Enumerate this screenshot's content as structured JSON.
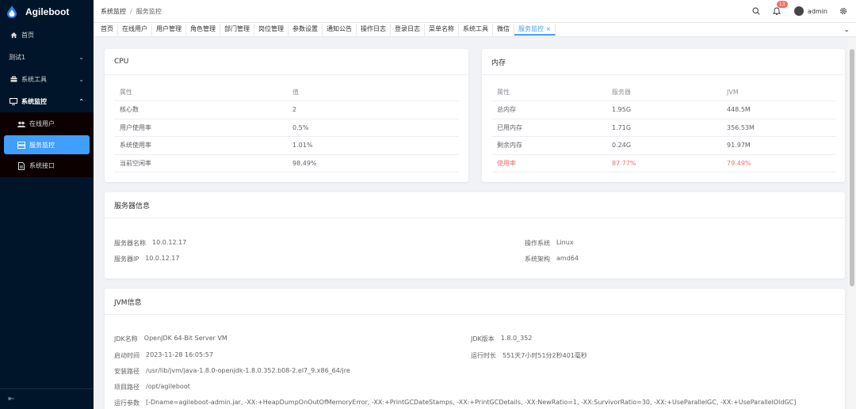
{
  "app": {
    "name": "Agileboot"
  },
  "sidebar": {
    "items": [
      {
        "label": "首页",
        "icon": "home-icon"
      },
      {
        "label": "测试1",
        "icon": ""
      },
      {
        "label": "系统工具",
        "icon": "toolbox-icon"
      },
      {
        "label": "系统监控",
        "icon": "monitor-icon"
      }
    ],
    "sub_items": [
      {
        "label": "在线用户",
        "icon": "users-icon"
      },
      {
        "label": "服务监控",
        "icon": "server-icon"
      },
      {
        "label": "系统接口",
        "icon": "document-icon"
      }
    ],
    "collapse_icon": "collapse-icon"
  },
  "header": {
    "breadcrumb": [
      "系统监控",
      "服务监控"
    ],
    "notice_count": "13",
    "username": "admin"
  },
  "tags": [
    "首页",
    "在线用户",
    "用户管理",
    "角色管理",
    "部门管理",
    "岗位管理",
    "参数设置",
    "通知公告",
    "操作日志",
    "登录日志",
    "菜单名称",
    "系统工具",
    "微信",
    "服务监控 ×"
  ],
  "cpu": {
    "title": "CPU",
    "headers": [
      "属性",
      "值"
    ],
    "rows": [
      [
        "核心数",
        "2"
      ],
      [
        "用户使用率",
        "0.5%"
      ],
      [
        "系统使用率",
        "1.01%"
      ],
      [
        "当前空闲率",
        "98.49%"
      ]
    ]
  },
  "memory": {
    "title": "内存",
    "headers": [
      "属性",
      "服务器",
      "JVM"
    ],
    "rows": [
      [
        "总内存",
        "1.95G",
        "448.5M"
      ],
      [
        "已用内存",
        "1.71G",
        "356.53M"
      ],
      [
        "剩余内存",
        "0.24G",
        "91.97M"
      ],
      [
        "使用率",
        "87.77%",
        "79.49%"
      ]
    ],
    "warn_color": "#f56c6c"
  },
  "server": {
    "title": "服务器信息",
    "name_label": "服务器名称",
    "name_value": "10.0.12.17",
    "ip_label": "服务器IP",
    "ip_value": "10.0.12.17",
    "os_label": "操作系统",
    "os_value": "Linux",
    "arch_label": "系统架构",
    "arch_value": "amd64"
  },
  "jvm": {
    "title": "JVM信息",
    "name_label": "JDK名称",
    "name_value": "OpenJDK 64-Bit Server VM",
    "version_label": "JDK版本",
    "version_value": "1.8.0_352",
    "start_label": "启动时间",
    "start_value": "2023-11-28 16:05:57",
    "runtime_label": "运行时长",
    "runtime_value": "551天7小时51分2秒401毫秒",
    "path_label": "安装路径",
    "path_value": "/usr/lib/jvm/java-1.8.0-openjdk-1.8.0.352.b08-2.el7_9.x86_64/jre",
    "project_label": "项目路径",
    "project_value": "/opt/agileboot",
    "args_label": "运行参数",
    "args_value": "[-Dname=agileboot-admin.jar, -XX:+HeapDumpOnOutOfMemoryError, -XX:+PrintGCDateStamps, -XX:+PrintGCDetails, -XX:NewRatio=1, -XX:SurvivorRatio=30, -XX:+UseParallelGC, -XX:+UseParallelOldGC]"
  },
  "colors": {
    "accent": "#409eff",
    "sidebar_bg": "#001529",
    "danger": "#f56c6c"
  }
}
